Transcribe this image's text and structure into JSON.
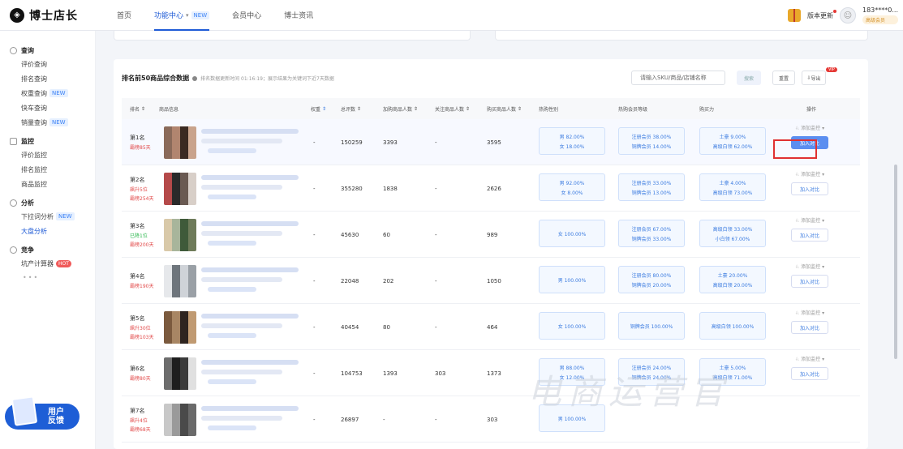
{
  "header": {
    "logo_text": "博士店长",
    "nav": [
      {
        "label": "首页"
      },
      {
        "label": "功能中心",
        "badge": "NEW"
      },
      {
        "label": "会员中心"
      },
      {
        "label": "博士资讯"
      }
    ],
    "update_label": "版本更新",
    "user_name": "183****0...",
    "user_level": "高级会员"
  },
  "sidebar": {
    "groups": [
      {
        "title": "查询",
        "items": [
          {
            "label": "评价查询"
          },
          {
            "label": "排名查询"
          },
          {
            "label": "权重查询",
            "badge": "NEW"
          },
          {
            "label": "快车查询"
          },
          {
            "label": "销量查询",
            "badge": "NEW"
          }
        ]
      },
      {
        "title": "监控",
        "items": [
          {
            "label": "评价监控"
          },
          {
            "label": "排名监控"
          },
          {
            "label": "商品监控"
          }
        ]
      },
      {
        "title": "分析",
        "items": [
          {
            "label": "下拉词分析",
            "badge": "NEW"
          },
          {
            "label": "大盘分析"
          }
        ]
      },
      {
        "title": "竞争",
        "items": [
          {
            "label": "坑产计算器",
            "badge": "HOT"
          }
        ]
      }
    ],
    "more": "•••",
    "feedback": "用户 反馈"
  },
  "panel": {
    "title": "排名前50商品综合数据",
    "note": "排名数据更新时间 01:16:19；展示结果为关键词下近7天数据",
    "search_placeholder": "请输入SKU/商品/店铺名称",
    "search_button": "搜索",
    "reset_button": "重置",
    "export_button": "导出",
    "vip": "VIP"
  },
  "table": {
    "headers": [
      "排名",
      "商品信息",
      "权重",
      "总评数",
      "加购商品人数",
      "关注商品人数",
      "购买商品人数",
      "热购性别",
      "热购会员等级",
      "购买力",
      "操作"
    ],
    "rows": [
      {
        "rank": "第1名",
        "sub": "霸榜85天",
        "sub2": "",
        "dash": "-",
        "reviews": "150259",
        "cart": "3393",
        "follow": "-",
        "buy": "3595",
        "gender": [
          "男 82.00%",
          "女 18.00%"
        ],
        "member": [
          "注册会员 38.00%",
          "铜牌会员 14.00%"
        ],
        "power": [
          "土豪 9.00%",
          "高级白领 62.00%"
        ],
        "watch": "添加监控",
        "add": "加入对比",
        "primary": true
      },
      {
        "rank": "第2名",
        "sub": "飙升5位",
        "sub2": "霸榜254天",
        "dash": "-",
        "reviews": "355280",
        "cart": "1838",
        "follow": "-",
        "buy": "2626",
        "gender": [
          "男 92.00%",
          "女 8.00%"
        ],
        "member": [
          "注册会员 33.00%",
          "铜牌会员 13.00%"
        ],
        "power": [
          "土豪 4.00%",
          "高级白领 73.00%"
        ],
        "watch": "添加监控",
        "add": "加入对比",
        "primary": false
      },
      {
        "rank": "第3名",
        "sub": "已降1位",
        "sub2": "霸榜200天",
        "dash": "-",
        "reviews": "45630",
        "cart": "60",
        "follow": "-",
        "buy": "989",
        "gender": [
          "女 100.00%"
        ],
        "member": [
          "注册会员 67.00%",
          "铜牌会员 33.00%"
        ],
        "power": [
          "高级白领 33.00%",
          "小白领 67.00%"
        ],
        "watch": "添加监控",
        "add": "加入对比",
        "primary": false
      },
      {
        "rank": "第4名",
        "sub": "霸榜190天",
        "sub2": "",
        "dash": "-",
        "reviews": "22048",
        "cart": "202",
        "follow": "-",
        "buy": "1050",
        "gender": [
          "男 100.00%"
        ],
        "member": [
          "注册会员 80.00%",
          "铜牌会员 20.00%"
        ],
        "power": [
          "土豪 20.00%",
          "高级白领 20.00%"
        ],
        "watch": "添加监控",
        "add": "加入对比",
        "primary": false
      },
      {
        "rank": "第5名",
        "sub": "飙升30位",
        "sub2": "霸榜103天",
        "dash": "-",
        "reviews": "40454",
        "cart": "80",
        "follow": "-",
        "buy": "464",
        "gender": [
          "女 100.00%"
        ],
        "member": [
          "铜牌会员 100.00%"
        ],
        "power": [
          "高级白领 100.00%"
        ],
        "watch": "添加监控",
        "add": "加入对比",
        "primary": false
      },
      {
        "rank": "第6名",
        "sub": "霸榜80天",
        "sub2": "",
        "dash": "-",
        "reviews": "104753",
        "cart": "1393",
        "follow": "303",
        "buy": "1373",
        "gender": [
          "男 88.00%",
          "女 12.00%"
        ],
        "member": [
          "注册会员 24.00%",
          "铜牌会员 24.00%"
        ],
        "power": [
          "土豪 5.00%",
          "高级白领 71.00%"
        ],
        "watch": "添加监控",
        "add": "加入对比",
        "primary": false
      },
      {
        "rank": "第7名",
        "sub": "飙升4位",
        "sub2": "霸榜68天",
        "dash": "-",
        "reviews": "26897",
        "cart": "-",
        "follow": "-",
        "buy": "303",
        "gender": [
          "男 100.00%"
        ],
        "member": [],
        "power": [],
        "watch": "",
        "add": "",
        "primary": false
      }
    ]
  },
  "watermark": "电商运营官"
}
